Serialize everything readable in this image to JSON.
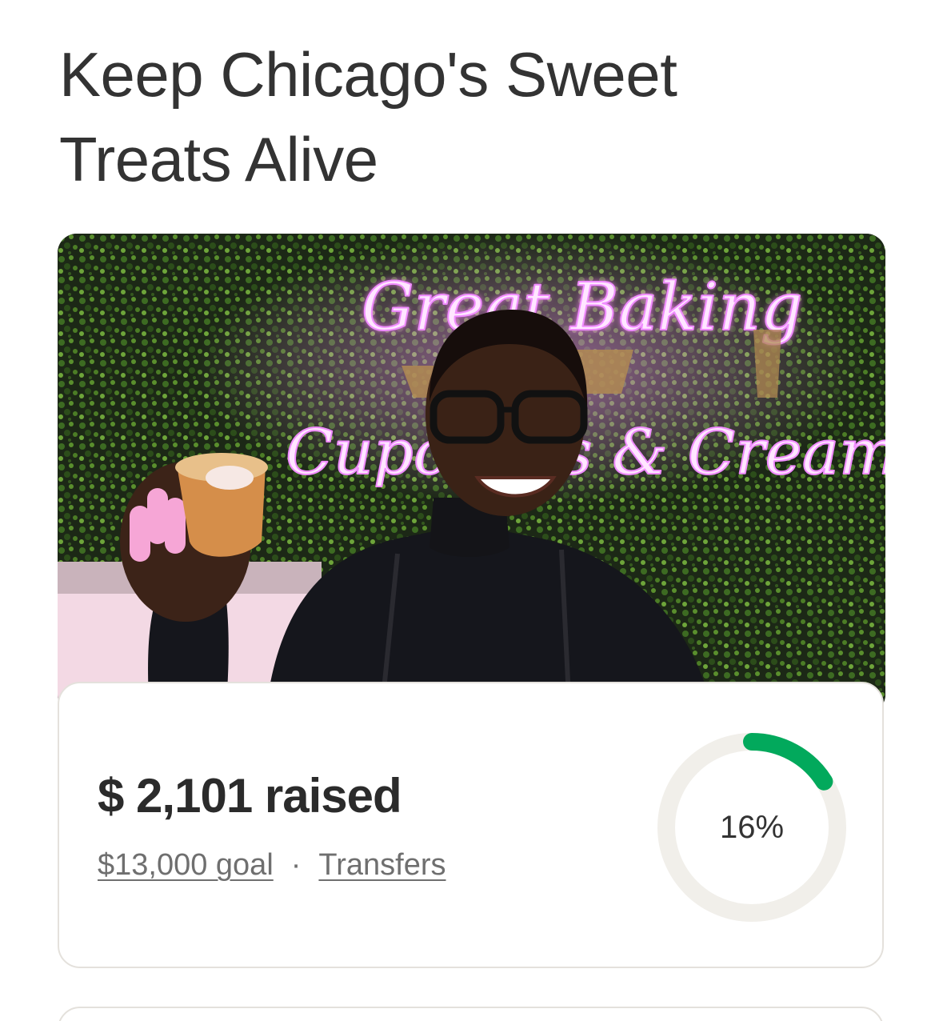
{
  "campaign": {
    "title": "Keep Chicago's Sweet Treats Alive"
  },
  "hero": {
    "sign_line1": "Great Baking",
    "sign_line2": "Cupcakes & Creamery"
  },
  "stats": {
    "raised": "$ 2,101 raised",
    "goal_link": "$13,000 goal",
    "separator": "·",
    "transfers_link": "Transfers",
    "progress_percent": 16,
    "progress_label": "16%"
  },
  "colors": {
    "progress_fill": "#02a95c",
    "progress_track": "#f1efea",
    "neon": "#f08cff"
  }
}
